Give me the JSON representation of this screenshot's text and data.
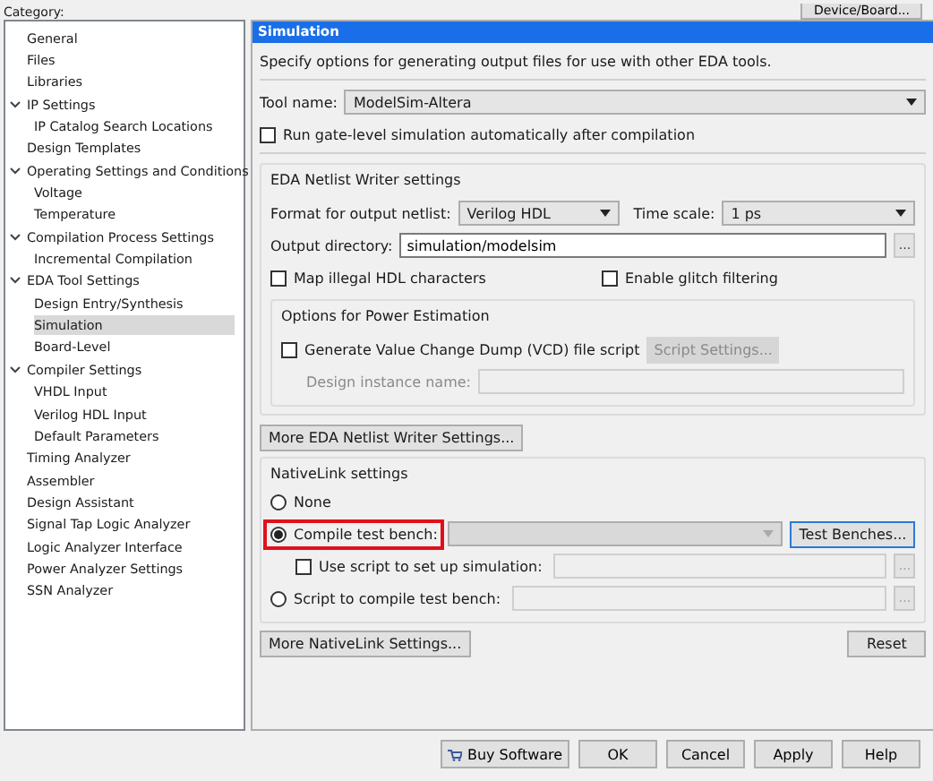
{
  "category_label": "Category:",
  "device_button": "Device/Board...",
  "sidebar": {
    "items": [
      {
        "label": "General",
        "selected": false
      },
      {
        "label": "Files",
        "selected": false
      },
      {
        "label": "Libraries",
        "selected": false
      },
      {
        "label": "IP Settings",
        "selected": false,
        "expanded": true,
        "children": [
          {
            "label": "IP Catalog Search Locations",
            "selected": false
          }
        ]
      },
      {
        "label": "Design Templates",
        "selected": false
      },
      {
        "label": "Operating Settings and Conditions",
        "selected": false,
        "expanded": true,
        "children": [
          {
            "label": "Voltage",
            "selected": false
          },
          {
            "label": "Temperature",
            "selected": false
          }
        ]
      },
      {
        "label": "Compilation Process Settings",
        "selected": false,
        "expanded": true,
        "children": [
          {
            "label": "Incremental Compilation",
            "selected": false
          }
        ]
      },
      {
        "label": "EDA Tool Settings",
        "selected": false,
        "expanded": true,
        "children": [
          {
            "label": "Design Entry/Synthesis",
            "selected": false
          },
          {
            "label": "Simulation",
            "selected": true
          },
          {
            "label": "Board-Level",
            "selected": false
          }
        ]
      },
      {
        "label": "Compiler Settings",
        "selected": false,
        "expanded": true,
        "children": [
          {
            "label": "VHDL Input",
            "selected": false
          },
          {
            "label": "Verilog HDL Input",
            "selected": false
          },
          {
            "label": "Default Parameters",
            "selected": false
          }
        ]
      },
      {
        "label": "Timing Analyzer",
        "selected": false
      },
      {
        "label": "Assembler",
        "selected": false
      },
      {
        "label": "Design Assistant",
        "selected": false
      },
      {
        "label": "Signal Tap Logic Analyzer",
        "selected": false
      },
      {
        "label": "Logic Analyzer Interface",
        "selected": false
      },
      {
        "label": "Power Analyzer Settings",
        "selected": false
      },
      {
        "label": "SSN Analyzer",
        "selected": false
      }
    ]
  },
  "panel": {
    "title": "Simulation",
    "description": "Specify options for generating output files for use with other EDA tools.",
    "tool_name": {
      "label": "Tool name:",
      "value": "ModelSim-Altera"
    },
    "run_gate_level": {
      "label": "Run gate-level simulation automatically after compilation",
      "checked": false
    },
    "netlist": {
      "title": "EDA Netlist Writer settings",
      "format": {
        "label": "Format for output netlist:",
        "value": "Verilog HDL"
      },
      "time_scale": {
        "label": "Time scale:",
        "value": "1 ps"
      },
      "output_directory": {
        "label": "Output directory:",
        "value": "simulation/modelsim",
        "browse": "..."
      },
      "map_illegal": {
        "label": "Map illegal HDL characters",
        "checked": false
      },
      "glitch": {
        "label": "Enable glitch filtering",
        "checked": false
      },
      "power": {
        "title": "Options for Power Estimation",
        "vcd": {
          "label": "Generate Value Change Dump (VCD) file script",
          "checked": false
        },
        "script_settings": {
          "label": "Script Settings...",
          "disabled": true
        },
        "instance": {
          "label": "Design instance name:",
          "disabled": true
        }
      }
    },
    "more_netlist_button": "More EDA Netlist Writer Settings...",
    "nativelink": {
      "title": "NativeLink settings",
      "options": [
        {
          "kind": "radio",
          "label": "None",
          "selected": false
        },
        {
          "kind": "radio",
          "label": "Compile test bench:",
          "selected": true,
          "highlighted": true,
          "field": {
            "kind": "dropdown"
          },
          "button": "Test Benches..."
        },
        {
          "kind": "checkbox",
          "label": "Use script to set up simulation:",
          "checked": false,
          "field": {
            "kind": "text"
          },
          "browse": "..."
        },
        {
          "kind": "radio",
          "label": "Script to compile test bench:",
          "selected": false,
          "field": {
            "kind": "text"
          },
          "browse": "..."
        }
      ]
    },
    "more_nativelink_button": "More NativeLink Settings...",
    "reset_button": "Reset"
  },
  "buttons": [
    {
      "kind": "cart",
      "label": "Buy Software"
    },
    {
      "kind": "plain",
      "label": "OK"
    },
    {
      "kind": "plain",
      "label": "Cancel"
    },
    {
      "kind": "plain",
      "label": "Apply"
    },
    {
      "kind": "plain",
      "label": "Help"
    }
  ]
}
